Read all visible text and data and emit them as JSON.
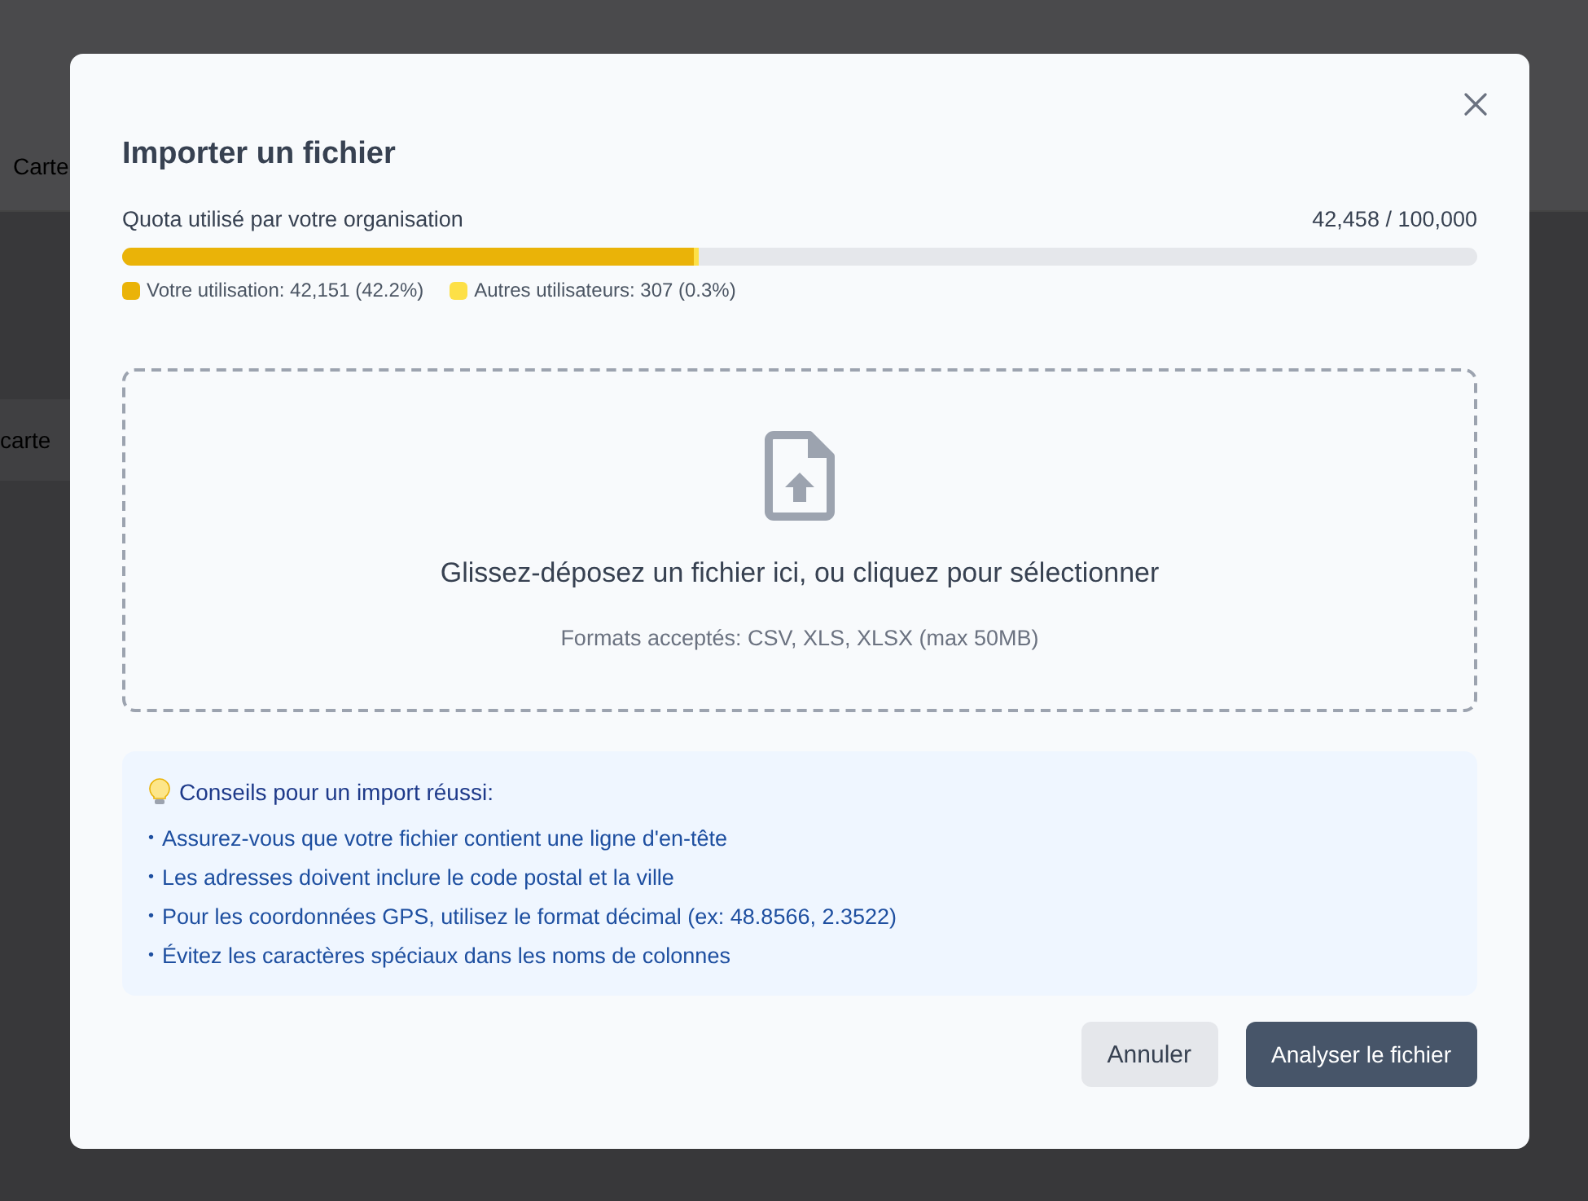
{
  "background": {
    "top_label": "Carte",
    "row_label": "carte"
  },
  "dialog": {
    "title": "Importer un fichier",
    "quota": {
      "label": "Quota utilisé par votre organisation",
      "total": "42,458 / 100,000",
      "segments": [
        {
          "label": "Votre utilisation: 42,151 (42.2%)",
          "level": 0.422,
          "color": "#eab308"
        },
        {
          "label": "Autres utilisateurs: 307 (0.3%)",
          "level": 0.003,
          "color": "#fde047"
        }
      ]
    },
    "dropzone": {
      "text": "Glissez-déposez un fichier ici, ou cliquez pour sélectionner",
      "hint": "Formats acceptés: CSV, XLS, XLSX (max 50MB)"
    },
    "tips": {
      "title": "Conseils pour un import réussi:",
      "items": [
        {
          "bullet": "•",
          "text": "Assurez-vous que votre fichier contient une ligne d'en-tête"
        },
        {
          "bullet": "•",
          "text": "Les adresses doivent inclure le code postal et la ville"
        },
        {
          "bullet": "•",
          "text": "Pour les coordonnées GPS, utilisez le format décimal (ex: 48.8566, 2.3522)"
        },
        {
          "bullet": "•",
          "text": "Évitez les caractères spéciaux dans les noms de colonnes"
        }
      ]
    },
    "buttons": [
      {
        "label": "Annuler",
        "kind": "secondary"
      },
      {
        "label": "Analyser le fichier",
        "kind": "primary"
      }
    ]
  }
}
